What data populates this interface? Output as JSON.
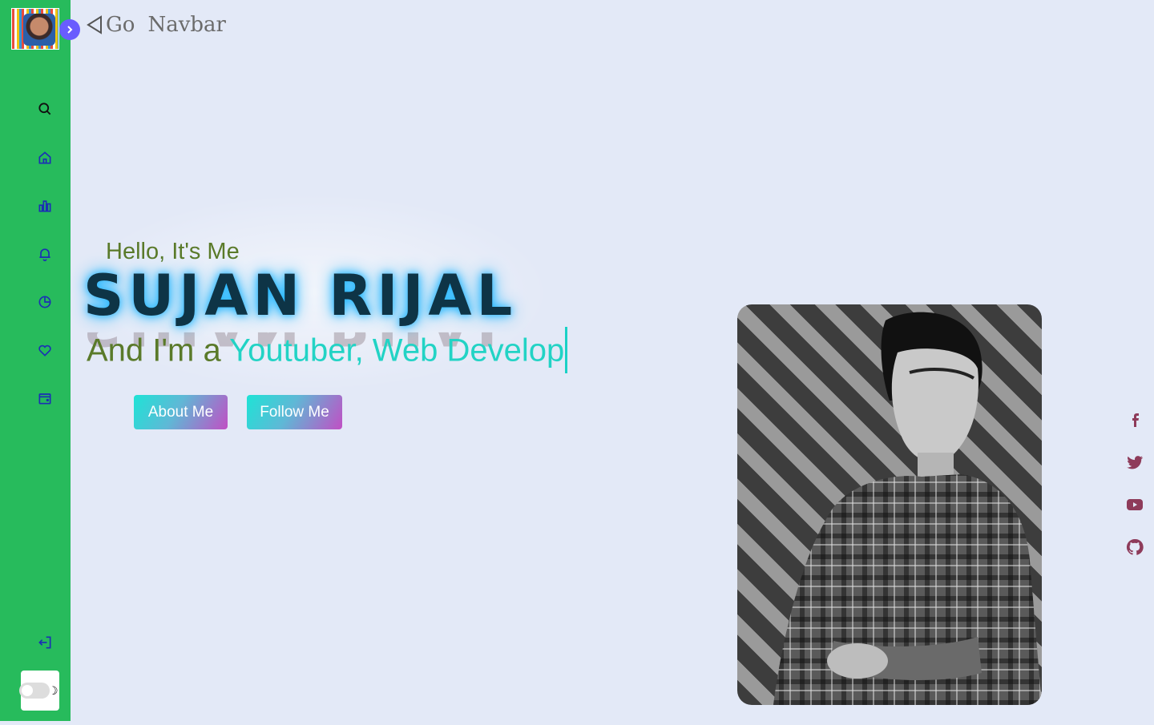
{
  "top": {
    "go_label": "Go",
    "navbar_label": "Navbar"
  },
  "hero": {
    "greeting": "Hello, It's Me",
    "name": "SUJAN RIJAL",
    "tag_prefix": "And I'm a ",
    "tag_typed": "Youtuber, Web Develop",
    "about_button": "About Me",
    "follow_button": "Follow Me"
  },
  "sidebar": {
    "items": [
      "search-icon",
      "home-icon",
      "bar-chart-icon",
      "bell-icon",
      "pie-chart-icon",
      "heart-icon",
      "wallet-icon"
    ],
    "logout_icon": "logout-icon",
    "theme_toggle": "dark-mode-switch"
  },
  "social": [
    "facebook-icon",
    "twitter-icon",
    "youtube-icon",
    "github-icon"
  ],
  "colors": {
    "background": "#e3e9f7",
    "sidebar": "#27bb5c",
    "accent": "#695cfe",
    "name_glow": "#21b6ff",
    "typed_text": "#22d3c5",
    "greeting": "#5a7a2a",
    "social": "#8e3b5a"
  }
}
